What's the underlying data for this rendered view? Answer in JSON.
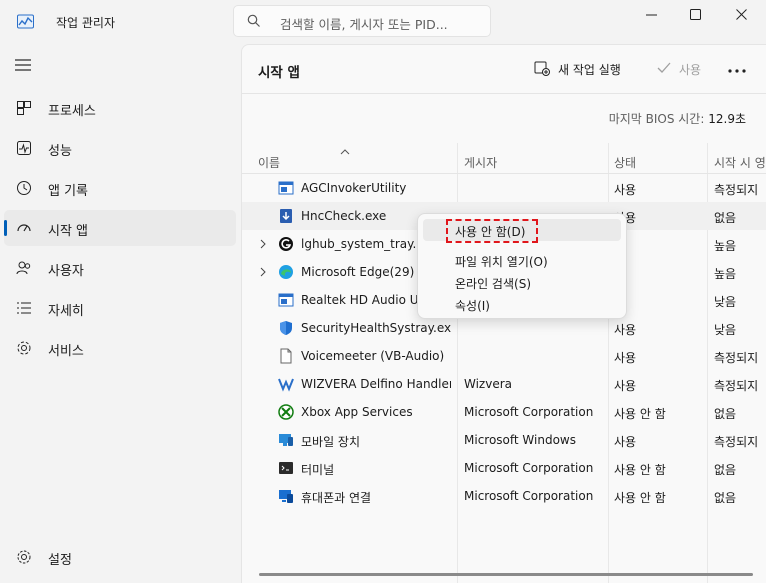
{
  "app": {
    "title": "작업 관리자"
  },
  "search": {
    "placeholder": "검색할 이름, 게시자 또는 PID..."
  },
  "window_controls": {
    "minimize": "—",
    "maximize": "☐",
    "close": "✕"
  },
  "sidebar": {
    "items": [
      {
        "label": "프로세스",
        "icon": "processes-icon"
      },
      {
        "label": "성능",
        "icon": "performance-icon"
      },
      {
        "label": "앱 기록",
        "icon": "app-history-icon"
      },
      {
        "label": "시작 앱",
        "icon": "startup-apps-icon",
        "active": true
      },
      {
        "label": "사용자",
        "icon": "users-icon"
      },
      {
        "label": "자세히",
        "icon": "details-icon"
      },
      {
        "label": "서비스",
        "icon": "services-icon"
      }
    ],
    "settings_label": "설정"
  },
  "page": {
    "title": "시작 앱",
    "toolbar": {
      "run_new_task": "새 작업 실행",
      "enable": "사용"
    },
    "bios_label": "마지막 BIOS 시간:",
    "bios_value": "12.9초"
  },
  "table": {
    "columns": [
      "이름",
      "게시자",
      "상태",
      "시작 시 영"
    ],
    "rows": [
      {
        "name": "AGCInvokerUtility",
        "publisher": "",
        "status": "사용",
        "impact": "측정되지",
        "icon": "app-window-icon"
      },
      {
        "name": "HncCheck.exe",
        "publisher": "",
        "status": "사용",
        "impact": "없음",
        "icon": "download-icon"
      },
      {
        "name": "lghub_system_tray.exe",
        "publisher": "",
        "status": "",
        "impact": "높음",
        "icon": "lghub-icon",
        "expandable": true
      },
      {
        "name": "Microsoft Edge(29)",
        "publisher": "",
        "status": "",
        "impact": "높음",
        "icon": "edge-icon",
        "expandable": true
      },
      {
        "name": "Realtek HD Audio Universal Service",
        "publisher": "",
        "status": "",
        "impact": "낮음",
        "icon": "app-window-icon"
      },
      {
        "name": "SecurityHealthSystray.exe",
        "publisher": "",
        "status": "사용",
        "impact": "낮음",
        "icon": "shield-icon"
      },
      {
        "name": "Voicemeeter (VB-Audio)",
        "publisher": "",
        "status": "사용",
        "impact": "측정되지",
        "icon": "file-icon"
      },
      {
        "name": "WIZVERA Delfino Handler...",
        "publisher": "Wizvera",
        "status": "사용",
        "impact": "측정되지",
        "icon": "wizvera-icon"
      },
      {
        "name": "Xbox App Services",
        "publisher": "Microsoft Corporation",
        "status": "사용 안 함",
        "impact": "없음",
        "icon": "xbox-icon"
      },
      {
        "name": "모바일 장치",
        "publisher": "Microsoft Windows",
        "status": "사용",
        "impact": "측정되지",
        "icon": "mobile-device-icon"
      },
      {
        "name": "터미널",
        "publisher": "Microsoft Corporation",
        "status": "사용 안 함",
        "impact": "없음",
        "icon": "terminal-icon"
      },
      {
        "name": "휴대폰과 연결",
        "publisher": "Microsoft Corporation",
        "status": "사용 안 함",
        "impact": "없음",
        "icon": "phone-link-icon"
      }
    ]
  },
  "context_menu": {
    "items": [
      "사용 안 함(D)",
      "파일 위치 열기(O)",
      "온라인 검색(S)",
      "속성(I)"
    ]
  },
  "colors": {
    "accent": "#005fb8",
    "highlight_dash": "#e0161b"
  }
}
